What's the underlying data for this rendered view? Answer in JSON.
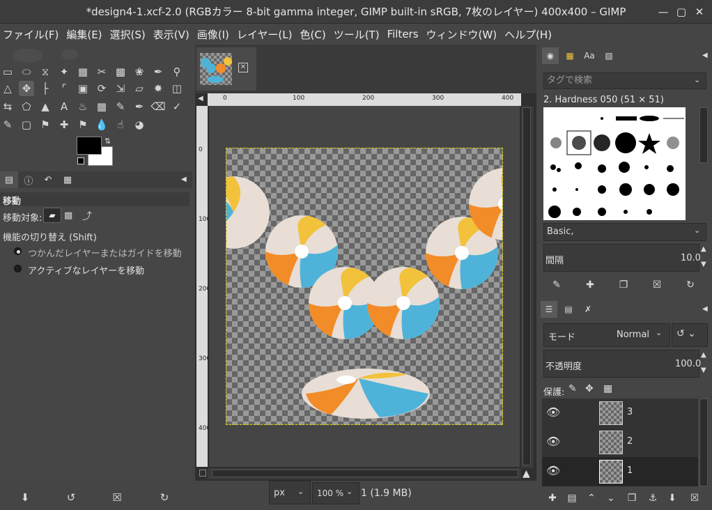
{
  "window": {
    "title": "*design4-1.xcf-2.0 (RGBカラー 8-bit gamma integer, GIMP built-in sRGB, 7枚のレイヤー) 400x400 – GIMP",
    "minimize_icon": "minimize-icon",
    "maximize_icon": "maximize-icon",
    "close_icon": "close-icon"
  },
  "menubar": {
    "items": [
      "ファイル(F)",
      "編集(E)",
      "選択(S)",
      "表示(V)",
      "画像(I)",
      "レイヤー(L)",
      "色(C)",
      "ツール(T)",
      "Filters",
      "ウィンドウ(W)",
      "ヘルプ(H)"
    ]
  },
  "colors": {
    "foreground": "#000000",
    "background": "#ffffff",
    "selection": "#e0d000",
    "ball_blue": "#4fb3d9",
    "ball_orange": "#f28c28",
    "ball_yellow": "#f2c23c"
  },
  "tool_options": {
    "title": "移動",
    "move_target_label": "移動対象:",
    "toggle_label": "機能の切り替え (Shift)",
    "radio_1": "つかんだレイヤーまたはガイドを移動",
    "radio_2": "アクティブなレイヤーを移動"
  },
  "canvas": {
    "ruler_h_labels": [
      "0",
      "100",
      "200",
      "300",
      "400"
    ],
    "ruler_v_labels": [
      "0",
      "100",
      "200",
      "300",
      "400"
    ]
  },
  "statusbar": {
    "unit": "px",
    "zoom": "100 %",
    "info": "1 (1.9 MB)"
  },
  "brushes": {
    "tag_placeholder": "タグで検索",
    "selected_brush": "2. Hardness 050 (51 × 51)",
    "preset": "Basic,",
    "spacing_label": "間隔",
    "spacing_value": "10.0"
  },
  "layers": {
    "mode_label": "モード",
    "mode_value": "Normal",
    "opacity_label": "不透明度",
    "opacity_value": "100.0",
    "lock_label": "保護:",
    "items": [
      {
        "name": "3",
        "visible": true,
        "selected": false
      },
      {
        "name": "2",
        "visible": true,
        "selected": false
      },
      {
        "name": "1",
        "visible": true,
        "selected": true
      }
    ]
  }
}
